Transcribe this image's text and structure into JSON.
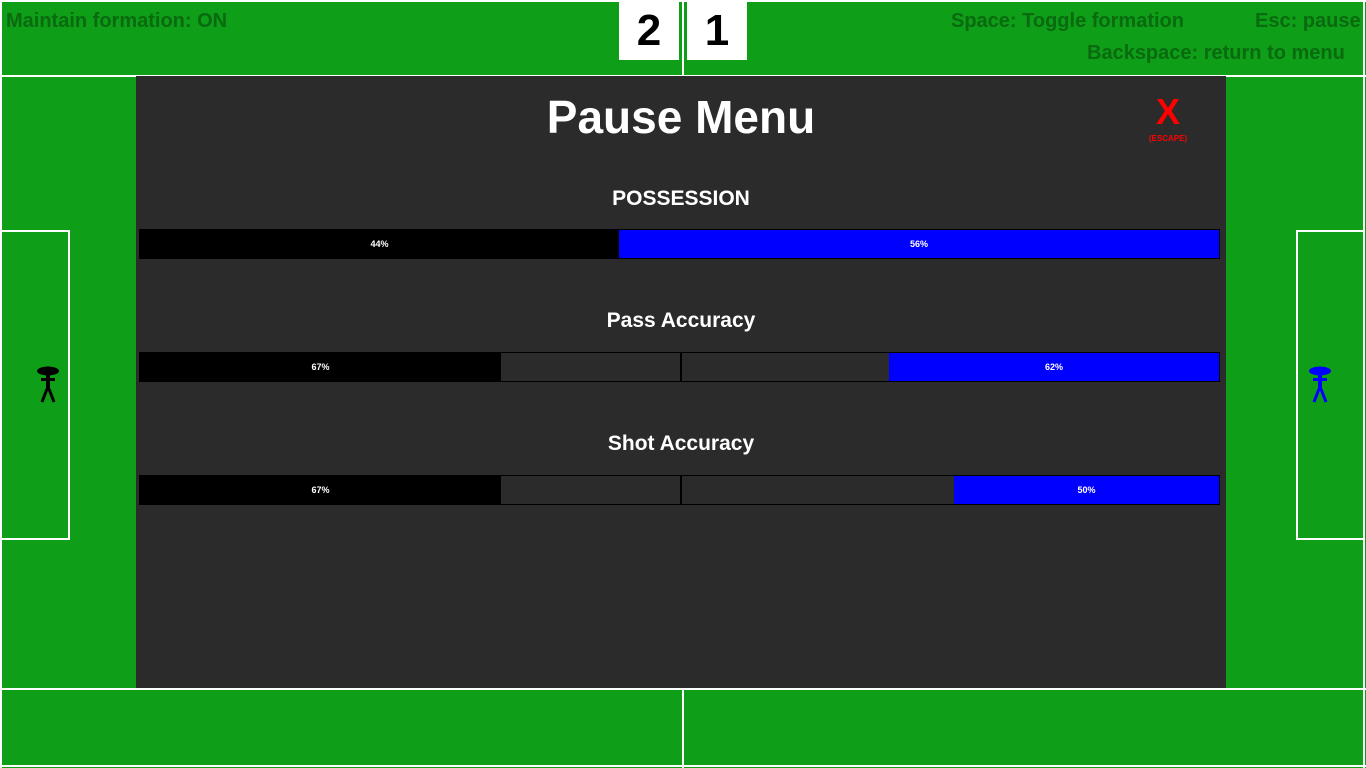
{
  "hud": {
    "formation_status": "Maintain formation: ON",
    "toggle_hint": "Space: Toggle formation",
    "pause_hint": "Esc: pause",
    "menu_hint": "Backspace: return to menu"
  },
  "score": {
    "home": "2",
    "away": "1"
  },
  "colors": {
    "pitch": "#0e9e17",
    "home_team": "#000000",
    "away_team": "#0000ff",
    "close": "#ff0000"
  },
  "pause_menu": {
    "title": "Pause Menu",
    "close_label": "X",
    "close_hint": "(ESCAPE)",
    "stats": [
      {
        "title": "POSSESSION",
        "home_label": "44%",
        "away_label": "56%",
        "home_value": 44,
        "away_value": 56
      },
      {
        "title": "Pass Accuracy",
        "home_label": "67%",
        "away_label": "62%",
        "home_value": 67,
        "away_value": 62
      },
      {
        "title": "Shot Accuracy",
        "home_label": "67%",
        "away_label": "50%",
        "home_value": 67,
        "away_value": 50
      }
    ]
  }
}
